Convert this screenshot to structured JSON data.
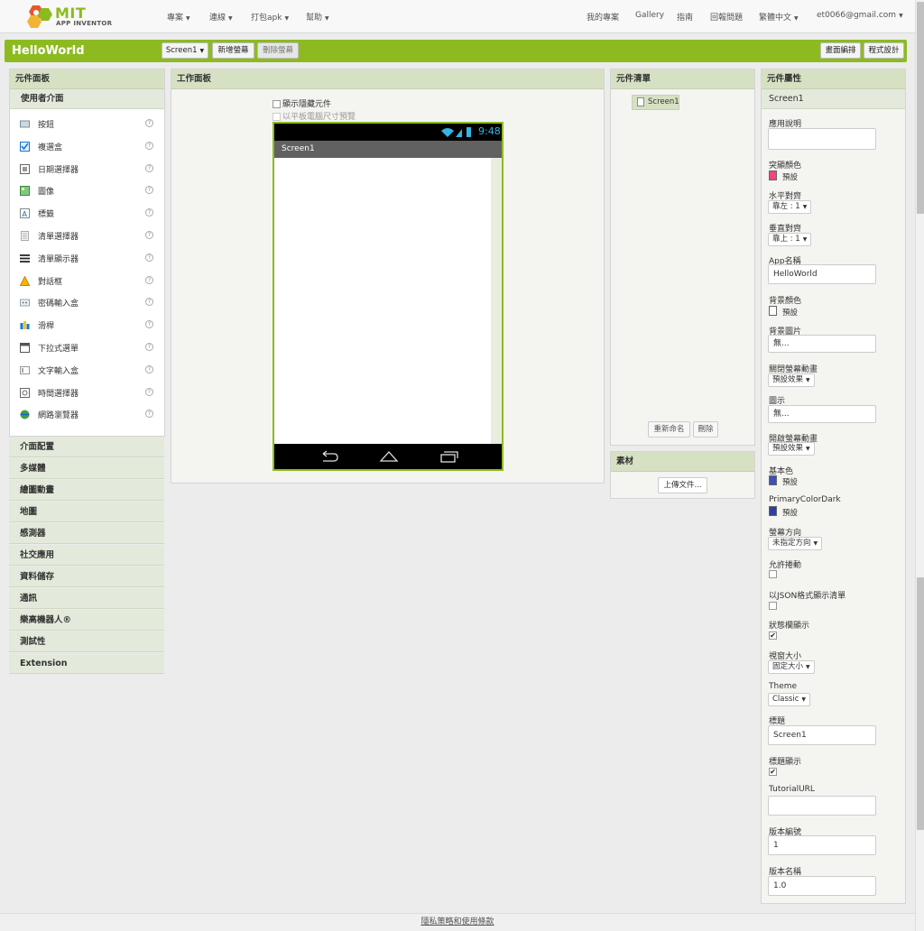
{
  "topbar": {
    "logo_mit": "MIT",
    "logo_ai": "APP INVENTOR",
    "menu_left": [
      "專案",
      "連線",
      "打包apk",
      "幫助"
    ],
    "menu_right": [
      "我的專案",
      "Gallery",
      "指南",
      "回報問題",
      "繁體中文",
      "et0066@gmail.com"
    ]
  },
  "toolbar": {
    "project_name": "HelloWorld",
    "screen_select": "Screen1",
    "add_screen": "新增螢幕",
    "remove_screen": "刪除螢幕",
    "designer": "畫面編排",
    "blocks": "程式設計"
  },
  "palette": {
    "title": "元件面板",
    "section": "使用者介面",
    "items": [
      {
        "label": "按鈕",
        "icon": "button-icon"
      },
      {
        "label": "複選盒",
        "icon": "checkbox-icon"
      },
      {
        "label": "日期選擇器",
        "icon": "datepicker-icon"
      },
      {
        "label": "圖像",
        "icon": "image-icon"
      },
      {
        "label": "標籤",
        "icon": "label-icon"
      },
      {
        "label": "清單選擇器",
        "icon": "listpicker-icon"
      },
      {
        "label": "清單顯示器",
        "icon": "listview-icon"
      },
      {
        "label": "對話框",
        "icon": "notifier-icon"
      },
      {
        "label": "密碼輸入盒",
        "icon": "passwordtextbox-icon"
      },
      {
        "label": "滑桿",
        "icon": "slider-icon"
      },
      {
        "label": "下拉式選單",
        "icon": "spinner-icon"
      },
      {
        "label": "文字輸入盒",
        "icon": "textbox-icon"
      },
      {
        "label": "時間選擇器",
        "icon": "timepicker-icon"
      },
      {
        "label": "網路瀏覽器",
        "icon": "webviewer-icon"
      }
    ],
    "help_glyph": "?",
    "categories": [
      "介面配置",
      "多媒體",
      "繪圖動畫",
      "地圖",
      "感測器",
      "社交應用",
      "資料儲存",
      "通訊",
      "樂高機器人®",
      "測試性",
      "Extension"
    ]
  },
  "viewer": {
    "title": "工作面板",
    "show_hidden": "顯示隱藏元件",
    "tablet_preview": "以平板電腦尺寸預覽",
    "phone_time": "9:48",
    "screen_title": "Screen1"
  },
  "components": {
    "title": "元件清單",
    "tree_item": "Screen1",
    "rename": "重新命名",
    "delete": "刪除"
  },
  "media": {
    "title": "素材",
    "upload": "上傳文件..."
  },
  "properties": {
    "title": "元件屬性",
    "component": "Screen1",
    "about_label": "應用說明",
    "accent_label": "突顯顏色",
    "accent_value": "預設",
    "accent_color": "#ff4081",
    "align_h_label": "水平對齊",
    "align_h_value": "靠左 : 1",
    "align_v_label": "垂直對齊",
    "align_v_value": "靠上 : 1",
    "appname_label": "App名稱",
    "appname_value": "HelloWorld",
    "bgcolor_label": "背景顏色",
    "bgcolor_value": "預設",
    "bgimage_label": "背景圖片",
    "bgimage_value": "無...",
    "close_anim_label": "關閉螢幕動畫",
    "close_anim_value": "預設效果",
    "icon_label": "圖示",
    "icon_value": "無...",
    "open_anim_label": "開啟螢幕動畫",
    "open_anim_value": "預設效果",
    "primary_label": "基本色",
    "primary_value": "預設",
    "primary_color": "#3f51b5",
    "primary_dark_label": "PrimaryColorDark",
    "primary_dark_value": "預設",
    "primary_dark_color": "#303f9f",
    "orientation_label": "螢幕方向",
    "orientation_value": "未指定方向",
    "scrollable_label": "允許捲動",
    "json_label": "以JSON格式顯示清單",
    "statusbar_label": "狀態欄顯示",
    "sizing_label": "視窗大小",
    "sizing_value": "固定大小",
    "theme_label": "Theme",
    "theme_value": "Classic",
    "title_label": "標題",
    "title_value": "Screen1",
    "title_visible_label": "標題顯示",
    "tutorial_label": "TutorialURL",
    "version_code_label": "版本編號",
    "version_code_value": "1",
    "version_name_label": "版本名稱",
    "version_name_value": "1.0"
  },
  "footer": {
    "privacy": "隱私策略和使用條款"
  }
}
